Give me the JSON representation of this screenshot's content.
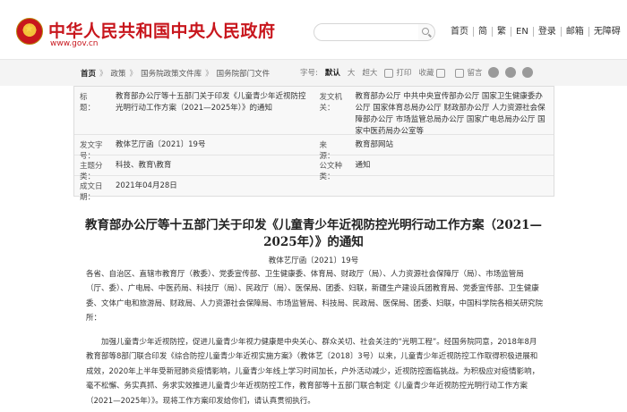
{
  "header": {
    "site_title": "中华人民共和国中央人民政府",
    "site_url": "www.gov.cn",
    "nav": [
      "首页",
      "简",
      "繁",
      "EN",
      "登录",
      "邮箱",
      "无障碍"
    ]
  },
  "breadcrumb": {
    "items": [
      "首页",
      "政策",
      "国务院政策文件库",
      "国务院部门文件"
    ],
    "separator": "》"
  },
  "toolbar": {
    "font_label": "字号:",
    "font_default": "默认",
    "font_large": "大",
    "font_xlarge": "超大",
    "print": "打印",
    "favorite": "收藏",
    "message": "留言"
  },
  "meta": {
    "title_label": "标　　题：",
    "title_value": "教育部办公厅等十五部门关于印发《儿童青少年近视防控光明行动工作方案（2021—2025年）》的通知",
    "issuer_label": "发文机关：",
    "issuer_value": "教育部办公厅  中共中央宣传部办公厅  国家卫生健康委办公厅  国家体育总局办公厅  财政部办公厅  人力资源社会保障部办公厅  市场监管总局办公厅  国家广电总局办公厅  国家中医药局办公室等",
    "docno_label": "发文字号：",
    "docno_value": "教体艺厅函〔2021〕19号",
    "source_label": "来　　源：",
    "source_value": "教育部网站",
    "subject_label": "主题分类：",
    "subject_value": "科技、教育\\教育",
    "type_label": "公文种类：",
    "type_value": "通知",
    "date_label": "成文日期：",
    "date_value": "2021年04月28日"
  },
  "document": {
    "title": "教育部办公厅等十五部门关于印发《儿童青少年近视防控光明行动工作方案（2021—2025年）》的通知",
    "doc_no": "教体艺厅函〔2021〕19号",
    "addressee": "各省、自治区、直辖市教育厅（教委）、党委宣传部、卫生健康委、体育局、财政厅（局）、人力资源社会保障厅（局）、市场监管局（厅、委）、广电局、中医药局、科技厅（局）、民政厅（局）、医保局、团委、妇联，新疆生产建设兵团教育局、党委宣传部、卫生健康委、文体广电和旅游局、财政局、人力资源社会保障局、市场监管局、科技局、民政局、医保局、团委、妇联，中国科学院各相关研究院所：",
    "paragraph1": "加强儿童青少年近视防控，促进儿童青少年视力健康是中央关心、群众关切、社会关注的“光明工程”。经国务院同意，2018年8月教育部等8部门联合印发《综合防控儿童青少年近视实施方案》（教体艺〔2018〕3号）以来，儿童青少年近视防控工作取得积极进展和成效，2020年上半年受新冠肺炎疫情影响，儿童青少年线上学习时间加长，户外活动减少，近视防控面临挑战。为积极应对疫情影响，毫不松懈、务实真抓、务求实效推进儿童青少年近视防控工作，教育部等十五部门联合制定《儿童青少年近视防控光明行动工作方案（2021—2025年）》。现将工作方案印发给你们，请认真贯彻执行。"
  }
}
